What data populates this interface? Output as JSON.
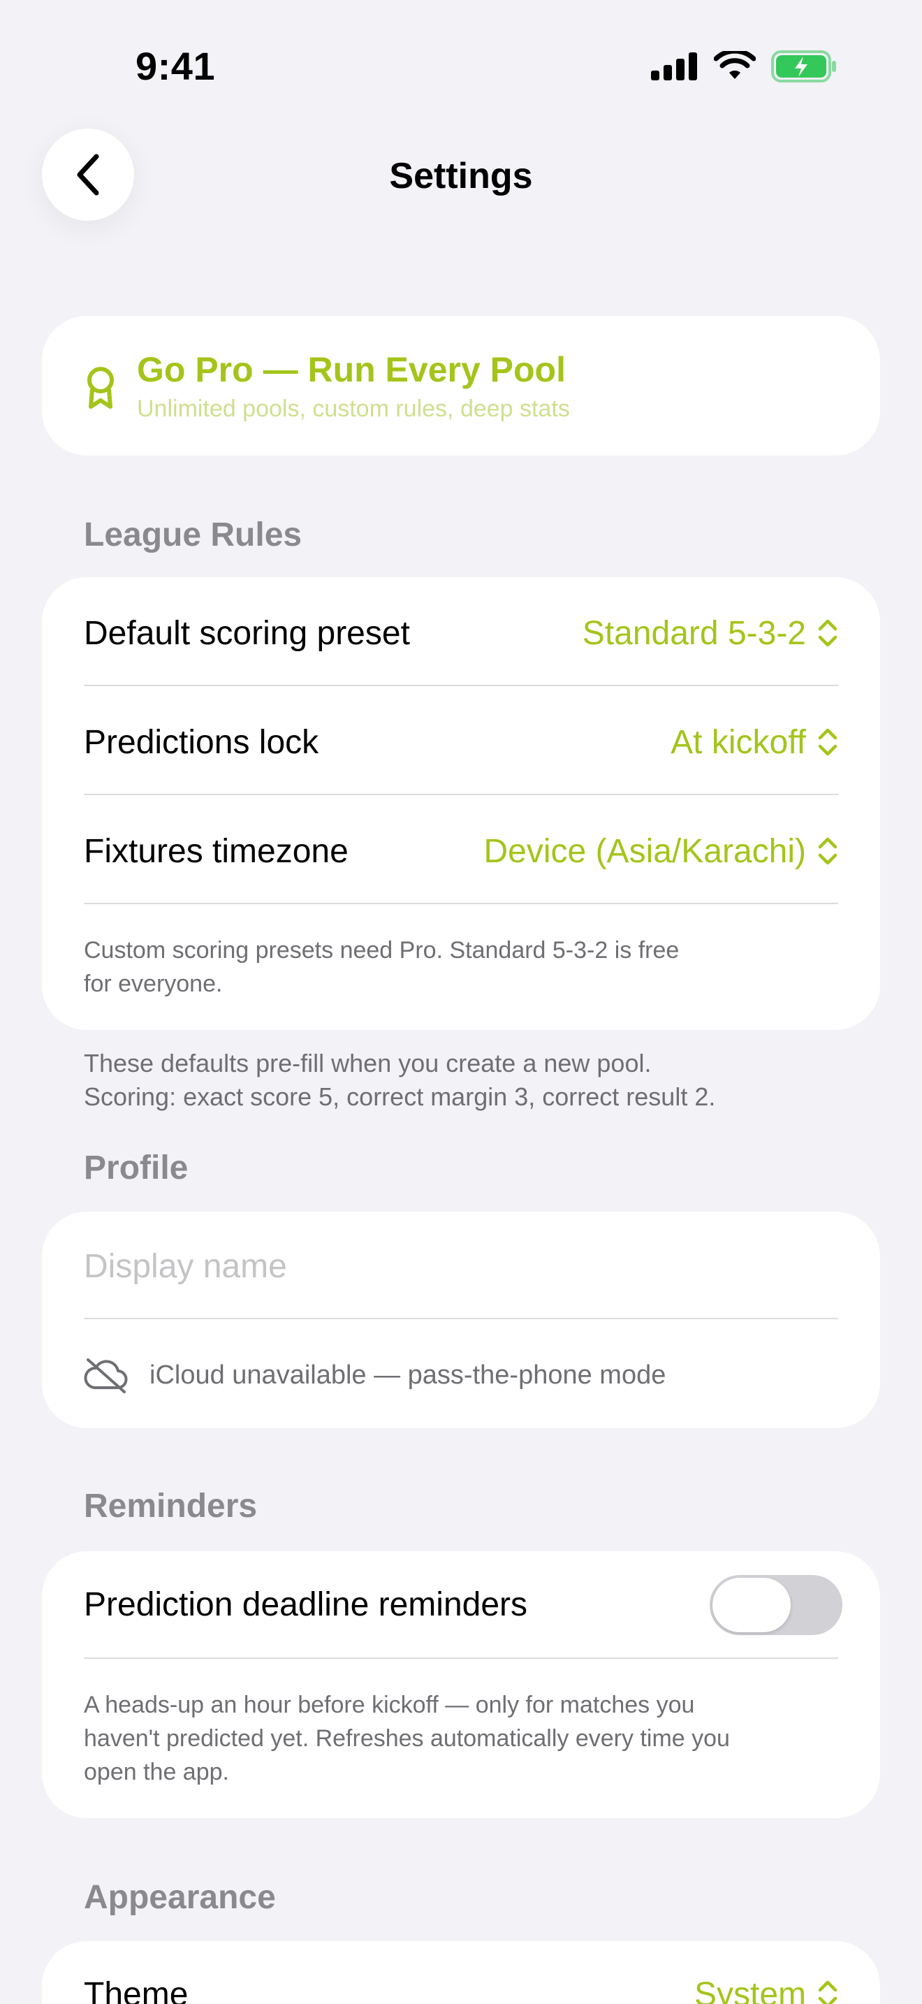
{
  "status_bar": {
    "time": "9:41"
  },
  "nav": {
    "title": "Settings"
  },
  "pro_banner": {
    "title": "Go Pro — Run Every Pool",
    "subtitle": "Unlimited pools, custom rules, deep stats"
  },
  "league_rules": {
    "header": "League Rules",
    "rows": [
      {
        "label": "Default scoring preset",
        "value": "Standard 5-3-2"
      },
      {
        "label": "Predictions lock",
        "value": "At kickoff"
      },
      {
        "label": "Fixtures timezone",
        "value": "Device (Asia/Karachi)"
      }
    ],
    "footnote_line1": "Custom scoring presets need Pro. Standard 5-3-2 is free",
    "footnote_line2": "for everyone.",
    "below_line1": "These defaults pre-fill when you create a new pool.",
    "below_line2": "Scoring: exact score 5, correct margin 3, correct result 2."
  },
  "profile": {
    "header": "Profile",
    "display_name_placeholder": "Display name",
    "icloud_note": "iCloud unavailable — pass-the-phone mode"
  },
  "reminders": {
    "header": "Reminders",
    "toggle_label": "Prediction deadline reminders",
    "toggle_on": false,
    "footnote_line1": "A heads-up an hour before kickoff — only for matches you",
    "footnote_line2": "haven't predicted yet. Refreshes automatically every time you",
    "footnote_line3": "open the app."
  },
  "appearance": {
    "header": "Appearance",
    "theme_label": "Theme",
    "theme_value": "System"
  },
  "colors": {
    "accent": "#A4C41A",
    "background": "#F2F2F7",
    "battery": "#34C759"
  }
}
